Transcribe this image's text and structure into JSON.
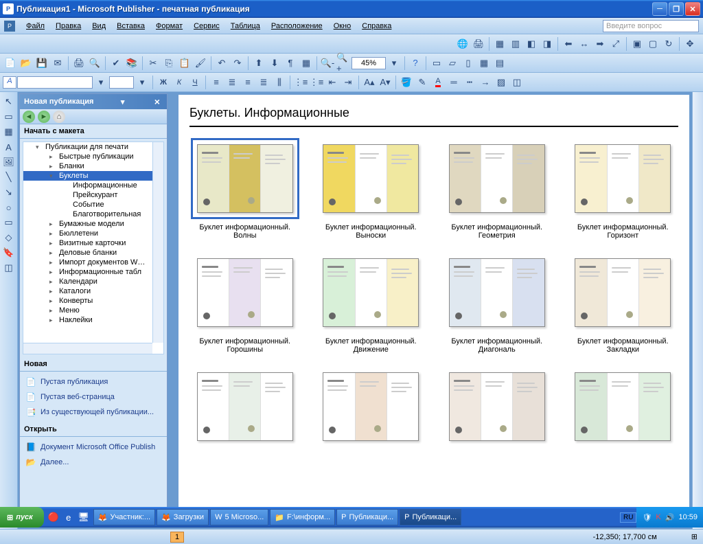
{
  "title": "Публикация1 - Microsoft Publisher - печатная публикация",
  "menus": [
    "Файл",
    "Правка",
    "Вид",
    "Вставка",
    "Формат",
    "Сервис",
    "Таблица",
    "Расположение",
    "Окно",
    "Справка"
  ],
  "askbox_placeholder": "Введите вопрос",
  "zoom": "45%",
  "font_indicator": "A",
  "taskpane": {
    "title": "Новая публикация",
    "section_start": "Начать с макета",
    "tree": [
      {
        "label": "Публикации для печати",
        "level": 1,
        "expanded": true
      },
      {
        "label": "Быстрые публикации",
        "level": 2
      },
      {
        "label": "Бланки",
        "level": 2
      },
      {
        "label": "Буклеты",
        "level": 2,
        "selected": true,
        "expanded": true
      },
      {
        "label": "Информационные",
        "level": 3
      },
      {
        "label": "Прейскурант",
        "level": 3
      },
      {
        "label": "Событие",
        "level": 3
      },
      {
        "label": "Благотворительная",
        "level": 3
      },
      {
        "label": "Бумажные модели",
        "level": 2
      },
      {
        "label": "Бюллетени",
        "level": 2
      },
      {
        "label": "Визитные карточки",
        "level": 2
      },
      {
        "label": "Деловые бланки",
        "level": 2
      },
      {
        "label": "Импорт документов W…",
        "level": 2
      },
      {
        "label": "Информационные табл",
        "level": 2
      },
      {
        "label": "Календари",
        "level": 2
      },
      {
        "label": "Каталоги",
        "level": 2
      },
      {
        "label": "Конверты",
        "level": 2
      },
      {
        "label": "Меню",
        "level": 2
      },
      {
        "label": "Наклейки",
        "level": 2
      }
    ],
    "section_new": "Новая",
    "new_links": [
      "Пустая публикация",
      "Пустая веб-страница",
      "Из существующей публикации..."
    ],
    "section_open": "Открыть",
    "open_links": [
      "Документ Microsoft Office Publish",
      "Далее..."
    ]
  },
  "gallery": {
    "heading": "Буклеты. Информационные",
    "items": [
      {
        "label": "Буклет информационный. Волны",
        "selected": true
      },
      {
        "label": "Буклет информационный. Выноски"
      },
      {
        "label": "Буклет информационный. Геометрия"
      },
      {
        "label": "Буклет информационный. Горизонт"
      },
      {
        "label": "Буклет информационный. Горошины"
      },
      {
        "label": "Буклет информационный. Движение"
      },
      {
        "label": "Буклет информационный. Диагональ"
      },
      {
        "label": "Буклет информационный. Закладки"
      },
      {
        "label": ""
      },
      {
        "label": ""
      },
      {
        "label": ""
      },
      {
        "label": ""
      }
    ]
  },
  "status": {
    "page_indicator": "1",
    "coords": "-12,350; 17,700 см"
  },
  "taskbar": {
    "start": "пуск",
    "items": [
      "Участник:...",
      "Загрузки",
      "5 Microso...",
      "F:\\информ...",
      "Публикаци...",
      "Публикаци..."
    ],
    "lang": "RU",
    "time": "10:59"
  }
}
